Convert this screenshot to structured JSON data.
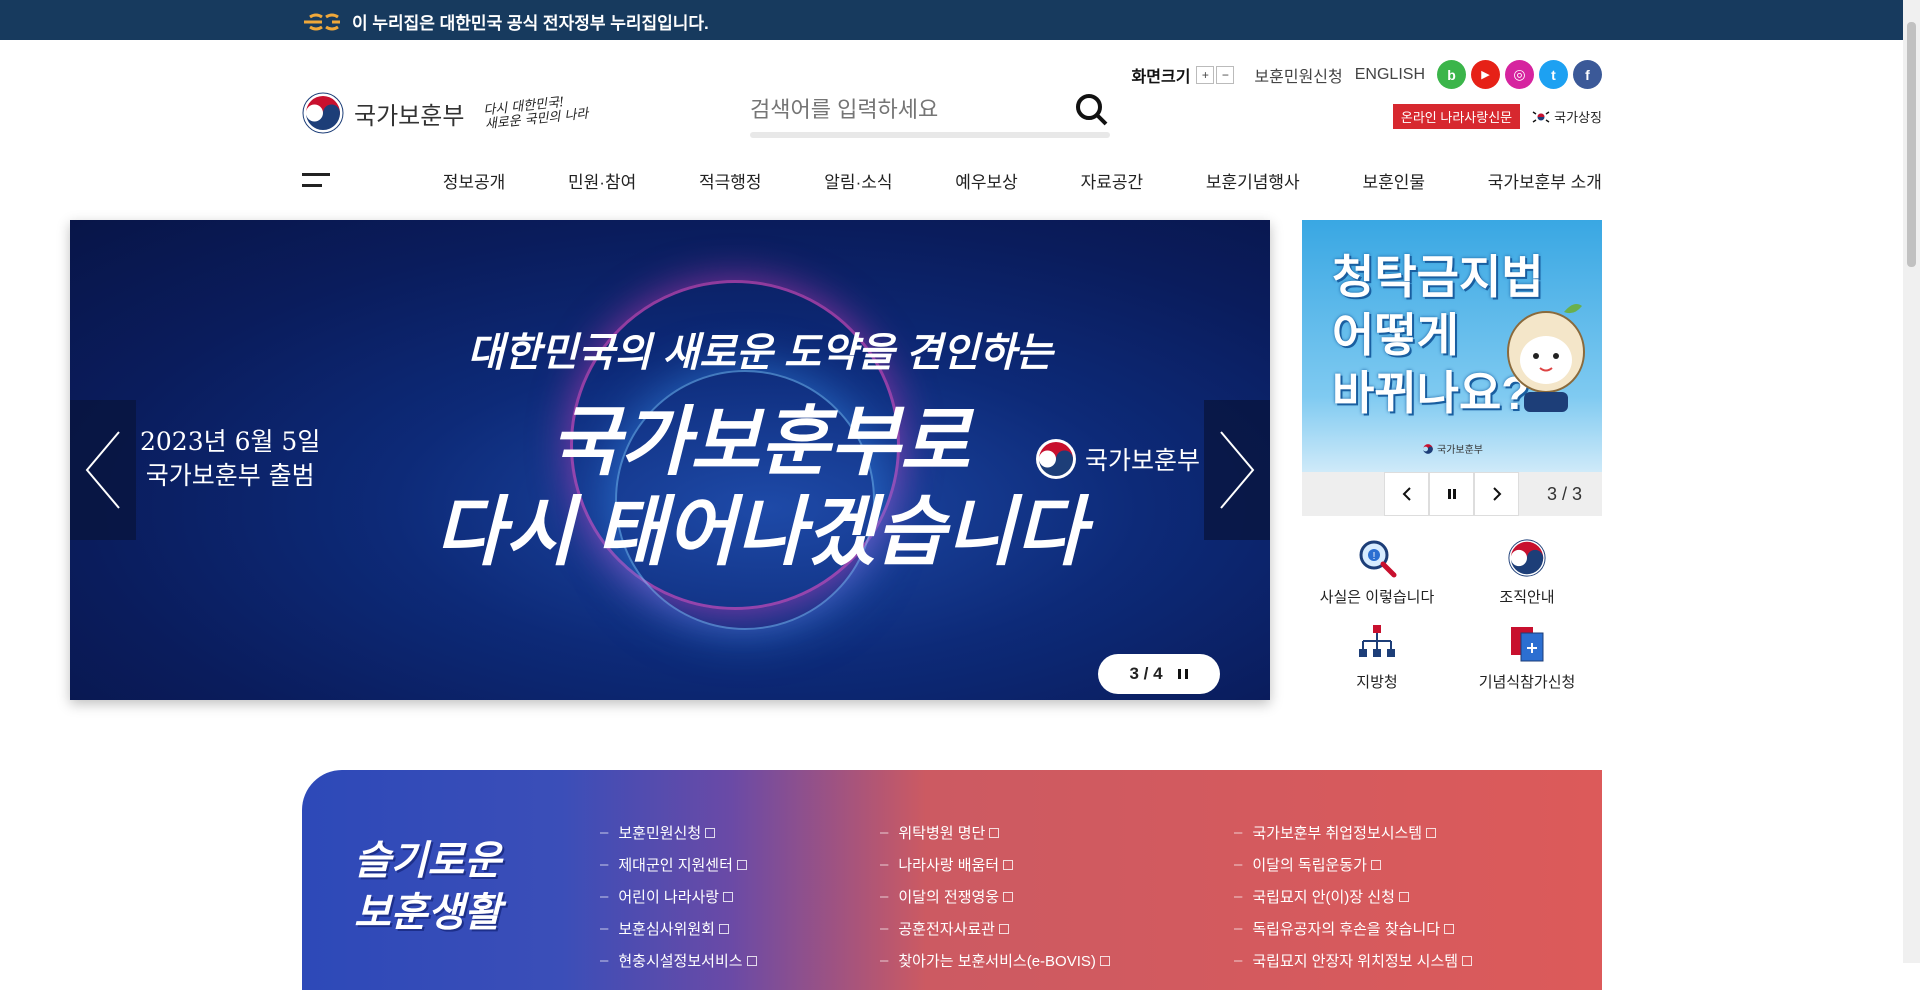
{
  "topbar": {
    "notice": "이 누리집은 대한민국 공식 전자정부 누리집입니다."
  },
  "header": {
    "org_name": "국가보훈부",
    "slogan_line1": "다시 대한민국!",
    "slogan_line2": "새로운 국민의 나라",
    "search_placeholder": "검색어를 입력하세요",
    "screen_size_label": "화면크기",
    "zoom_in": "+",
    "zoom_out": "−",
    "link_civil": "보훈민원신청",
    "link_english": "ENGLISH",
    "social": [
      {
        "icon": "blog-icon",
        "glyph": "b",
        "color": "#3bb54a"
      },
      {
        "icon": "youtube-icon",
        "glyph": "▶",
        "color": "#e62117"
      },
      {
        "icon": "instagram-icon",
        "glyph": "◎",
        "color": "#d6249f"
      },
      {
        "icon": "twitter-icon",
        "glyph": "t",
        "color": "#1da1f2"
      },
      {
        "icon": "facebook-icon",
        "glyph": "f",
        "color": "#3b5998"
      }
    ],
    "newspaper_button": "온라인 나라사랑신문",
    "national_symbol": "국가상징"
  },
  "gnb": [
    "정보공개",
    "민원·참여",
    "적극행정",
    "알림·소식",
    "예우보상",
    "자료공간",
    "보훈기념행사",
    "보훈인물",
    "국가보훈부 소개"
  ],
  "slider": {
    "date_line1": "2023년 6월 5일",
    "date_line2": "국가보훈부 출범",
    "headline_small": "대한민국의 새로운 도약을 견인하는",
    "headline_big1": "국가보훈부로",
    "headline_big2": "다시 태어나겠습니다",
    "brand": "국가보훈부",
    "pager": "3 / 4"
  },
  "side_banner": {
    "line1": "청탁금지법",
    "line2": "어떻게",
    "line3": "바뀌나요?",
    "small_brand": "국가보훈부",
    "counter": "3 / 3"
  },
  "quick_menu": [
    {
      "label": "사실은 이렇습니다",
      "icon": "fact-check-icon"
    },
    {
      "label": "조직안내",
      "icon": "organization-icon"
    },
    {
      "label": "지방청",
      "icon": "regional-office-icon"
    },
    {
      "label": "기념식참가신청",
      "icon": "ceremony-apply-icon"
    }
  ],
  "wise_life": {
    "title_line1": "슬기로운",
    "title_line2": "보훈생활",
    "col1": [
      "보훈민원신청",
      "제대군인 지원센터",
      "어린이 나라사랑",
      "보훈심사위원회",
      "현충시설정보서비스"
    ],
    "col2": [
      "위탁병원 명단",
      "나라사랑 배움터",
      "이달의 전쟁영웅",
      "공훈전자사료관",
      "찾아가는 보훈서비스(e-BOVIS)"
    ],
    "col3": [
      "국가보훈부 취업정보시스템",
      "이달의 독립운동가",
      "국립묘지 안(이)장 신청",
      "독립유공자의 후손을 찾습니다",
      "국립묘지 안장자 위치정보 시스템"
    ]
  },
  "colors": {
    "topbar": "#173a5e",
    "accent_red": "#d7282f",
    "slider_bg": "#0a1c5c"
  }
}
